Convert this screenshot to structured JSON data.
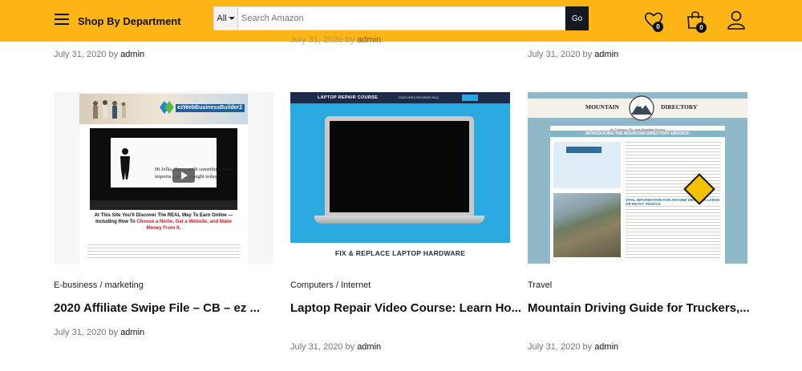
{
  "header": {
    "department_label": "Shop By Department",
    "search": {
      "category": "All",
      "placeholder": "Search Amazon",
      "button_label": "Go"
    },
    "wishlist_count": "0",
    "cart_count": "0",
    "icons": [
      "menu-icon",
      "heart-icon",
      "shopping-bag-icon",
      "user-icon"
    ],
    "accent_color": "#fdb615"
  },
  "top_posts": [
    {
      "date": "July 31, 2020",
      "by": "by",
      "author": "admin"
    },
    {
      "date": "July 31, 2020",
      "by": "by",
      "author": "admin"
    },
    {
      "date": "July 31, 2020",
      "by": "by",
      "author": "admin"
    }
  ],
  "posts": [
    {
      "categories": [
        "E-business",
        "marketing"
      ],
      "separator": "/",
      "title": "2020 Affiliate Swipe File – CB – ez ...",
      "date": "July 31, 2020",
      "by": "by",
      "author": "admin",
      "thumbnail": {
        "logo_text": "ezWebBusinessBuilder2",
        "video_text": "Hi folks, Jim ... with something really importa... to set straight today.",
        "headline": "At This Site You'll Discover The REAL Way To Earn Online — Including How To",
        "headline_red": "Choose a Niche, Get a Website, and Make Money From It."
      }
    },
    {
      "categories": [
        "Computers",
        "Internet"
      ],
      "separator": "/",
      "title": "Laptop Repair Video Course: Learn Ho...",
      "date": "July 31, 2020",
      "by": "by",
      "author": "admin",
      "thumbnail": {
        "nav_title": "LAPTOP REPAIR COURSE",
        "nav_items": "FEATURES   REVIEWS   FAQ",
        "caption": "FIX & REPLACE LAPTOP HARDWARE"
      }
    },
    {
      "categories": [
        "Travel"
      ],
      "separator": "",
      "title": "Mountain Driving Guide for Truckers,...",
      "date": "July 31, 2020",
      "by": "by",
      "author": "admin",
      "thumbnail": {
        "brand_left": "MOUNTAIN",
        "brand_right": "DIRECTORY",
        "subtitle": "for Truckers, RV, and Mountain Drivers",
        "intro": "INTRODUCING THE MOUNTAIN DIRECTORY EBOOKS!",
        "vital": "VITAL INFORMATION FOR ANYONE DRIVING A LARGE OR HEAVY VEHICLE"
      }
    }
  ]
}
